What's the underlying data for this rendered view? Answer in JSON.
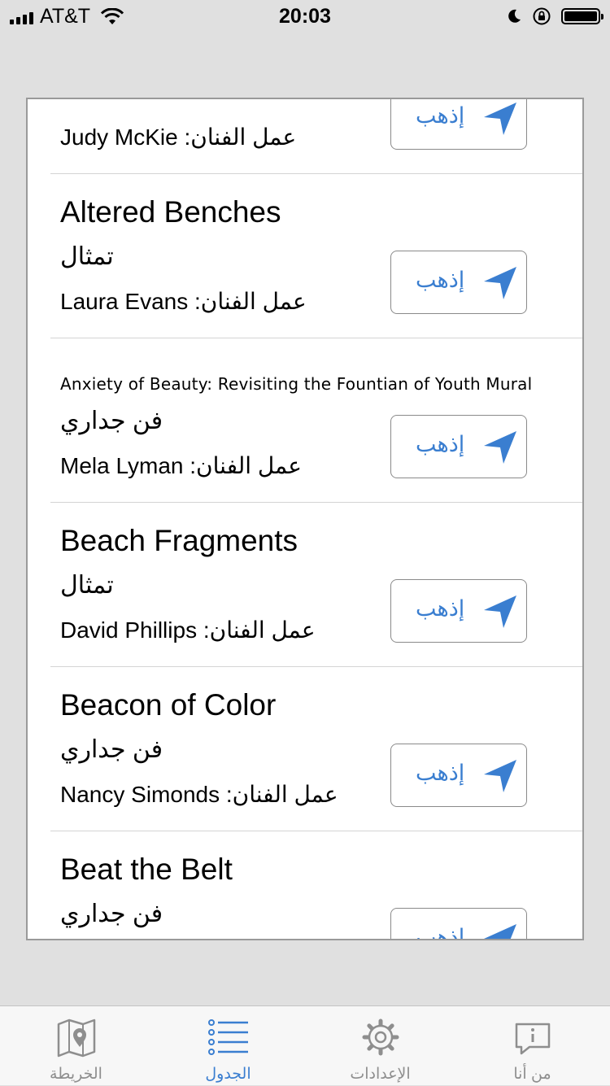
{
  "status_bar": {
    "carrier": "AT&T",
    "time": "20:03"
  },
  "list": {
    "rows": [
      {
        "title": "",
        "type": "",
        "artist": "Judy McKie :عمل الفنان",
        "button_label": "إذهب"
      },
      {
        "title": "Altered Benches",
        "type": "تمثال",
        "artist": "Laura Evans :عمل الفنان",
        "button_label": "إذهب"
      },
      {
        "title": "Anxiety of Beauty: Revisiting the Fountian of Youth Mural",
        "type": "فن جداري",
        "artist": "Mela Lyman :عمل الفنان",
        "button_label": "إذهب"
      },
      {
        "title": "Beach Fragments",
        "type": "تمثال",
        "artist": "David Phillips :عمل الفنان",
        "button_label": "إذهب"
      },
      {
        "title": "Beacon of Color",
        "type": "فن جداري",
        "artist": "Nancy Simonds :عمل الفنان",
        "button_label": "إذهب"
      },
      {
        "title": "Beat the Belt",
        "type": "فن جداري",
        "artist": "",
        "button_label": "إذهب"
      }
    ]
  },
  "tab_bar": {
    "tabs": [
      {
        "label": "الخريطة",
        "icon": "map-icon",
        "active": false
      },
      {
        "label": "الجدول",
        "icon": "list-icon",
        "active": true
      },
      {
        "label": "الإعدادات",
        "icon": "gear-icon",
        "active": false
      },
      {
        "label": "من أنا",
        "icon": "info-bubble-icon",
        "active": false
      }
    ]
  },
  "colors": {
    "accent": "#3a7ed0",
    "inactive_tab": "#8e8e8e",
    "background": "#e0e0e0"
  }
}
